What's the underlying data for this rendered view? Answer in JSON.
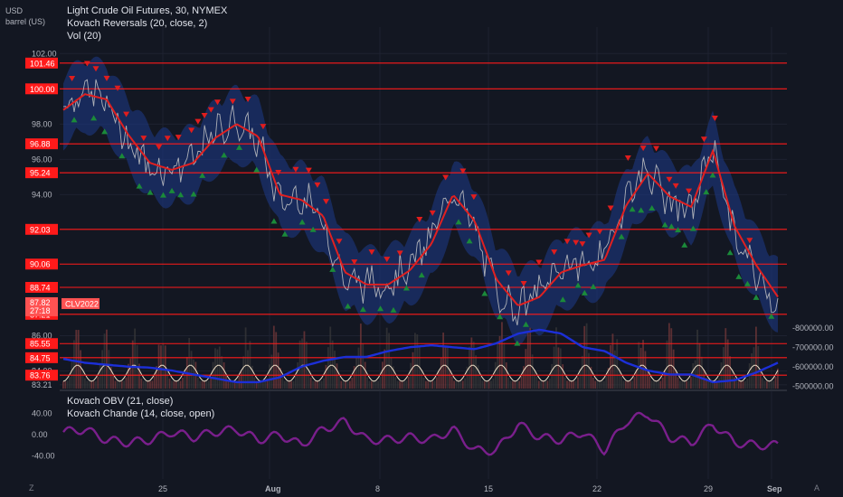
{
  "header": {
    "unit_line1": "USD",
    "unit_line2": "barrel (US)",
    "title": "Light Crude Oil Futures, 30, NYMEX",
    "indicator1": "Kovach Reversals (20, close, 2)",
    "indicator2": "Vol (20)"
  },
  "oscillator": {
    "label1": "Kovach OBV (21, close)",
    "label2": "Kovach Chande (14, close, open)"
  },
  "footer": {
    "left_button": "Z",
    "right_button": "A"
  },
  "colors": {
    "background": "#131722",
    "grid": "#1e2230",
    "level_line": "#ff1a1a",
    "level_tag": "#ff1a1a",
    "price_line": "#c8c8c8",
    "ma_line": "#e02020",
    "band": "#1e3a8a",
    "buy_marker": "#1b8a3a",
    "sell_marker": "#e01d1d",
    "obv": "#1c2fd8",
    "chande": "#7a1f8c"
  },
  "chart_data": [
    {
      "type": "line",
      "title": "Light Crude Oil Futures, 30, NYMEX",
      "symbol_tag": "CLV2022",
      "y_ticks": [
        102.0,
        98.0,
        96.0,
        94.0,
        86.0,
        84.0,
        83.21
      ],
      "ylim": [
        83.0,
        103.5
      ],
      "x_ticks": [
        "25",
        "Aug",
        "8",
        "15",
        "22",
        "29",
        "Sep"
      ],
      "price_levels": [
        101.46,
        100.0,
        96.88,
        95.24,
        92.03,
        90.06,
        88.74,
        87.21,
        85.55,
        84.75,
        83.76
      ],
      "last_price": 87.82,
      "countdown": "27:18",
      "series": [
        {
          "name": "close",
          "x": [
            "Jul 18",
            "Jul 19",
            "Jul 20",
            "Jul 21",
            "Jul 22",
            "Jul 25",
            "Jul 26",
            "Jul 27",
            "Jul 28",
            "Jul 29",
            "Aug 1",
            "Aug 2",
            "Aug 3",
            "Aug 4",
            "Aug 5",
            "Aug 8",
            "Aug 9",
            "Aug 10",
            "Aug 11",
            "Aug 12",
            "Aug 15",
            "Aug 16",
            "Aug 17",
            "Aug 18",
            "Aug 19",
            "Aug 22",
            "Aug 23",
            "Aug 24",
            "Aug 25",
            "Aug 26",
            "Aug 29",
            "Aug 30",
            "Aug 31",
            "Sep 1"
          ],
          "values": [
            99.0,
            100.0,
            99.2,
            97.0,
            95.5,
            95.5,
            96.0,
            97.5,
            98.2,
            97.0,
            93.5,
            94.0,
            92.5,
            89.0,
            89.0,
            89.0,
            90.0,
            91.5,
            94.5,
            92.0,
            88.5,
            87.5,
            88.5,
            90.0,
            90.0,
            90.5,
            94.0,
            95.5,
            93.5,
            93.0,
            97.0,
            91.5,
            89.5,
            87.82
          ]
        },
        {
          "name": "Kovach Reversals",
          "x": [
            "Jul 18",
            "Jul 19",
            "Jul 20",
            "Jul 21",
            "Jul 22",
            "Jul 25",
            "Jul 26",
            "Jul 27",
            "Jul 28",
            "Jul 29",
            "Aug 1",
            "Aug 2",
            "Aug 3",
            "Aug 4",
            "Aug 5",
            "Aug 8",
            "Aug 9",
            "Aug 10",
            "Aug 11",
            "Aug 12",
            "Aug 15",
            "Aug 16",
            "Aug 17",
            "Aug 18",
            "Aug 19",
            "Aug 22",
            "Aug 23",
            "Aug 24",
            "Aug 25",
            "Aug 26",
            "Aug 29",
            "Aug 30",
            "Aug 31",
            "Sep 1"
          ],
          "values": [
            98.8,
            99.7,
            99.4,
            97.4,
            95.8,
            95.4,
            95.8,
            97.2,
            98.0,
            97.3,
            94.0,
            93.7,
            92.8,
            89.6,
            88.9,
            88.9,
            89.7,
            91.2,
            94.0,
            92.5,
            89.2,
            87.7,
            88.2,
            89.6,
            90.0,
            90.3,
            93.4,
            95.2,
            93.9,
            93.3,
            96.5,
            92.2,
            90.0,
            88.2
          ]
        }
      ],
      "buy_signals": 48,
      "sell_signals": 64
    },
    {
      "type": "line",
      "title": "",
      "y_ticks_left": [
        40.0,
        0.0,
        -40.0
      ],
      "y_ticks_right": [
        -500000.0,
        -600000.0,
        -700000.0,
        -800000.0
      ],
      "series": [
        {
          "name": "Kovach OBV (21, close)",
          "values": [
            -640000,
            -620000,
            -610000,
            -600000,
            -595000,
            -580000,
            -560000,
            -540000,
            -520000,
            -520000,
            -545000,
            -600000,
            -630000,
            -650000,
            -650000,
            -680000,
            -700000,
            -710000,
            -700000,
            -690000,
            -720000,
            -770000,
            -790000,
            -770000,
            -700000,
            -680000,
            -620000,
            -580000,
            -560000,
            -560000,
            -520000,
            -530000,
            -570000,
            -620000
          ]
        },
        {
          "name": "Kovach Chande (14, close, open)",
          "values": [
            5,
            10,
            -10,
            -15,
            -10,
            5,
            -5,
            5,
            10,
            -10,
            0,
            -20,
            10,
            25,
            -10,
            -10,
            -5,
            -10,
            10,
            -30,
            -30,
            20,
            -5,
            -10,
            5,
            -30,
            25,
            40,
            -5,
            -15,
            20,
            -15,
            -20,
            -20
          ]
        }
      ]
    }
  ]
}
